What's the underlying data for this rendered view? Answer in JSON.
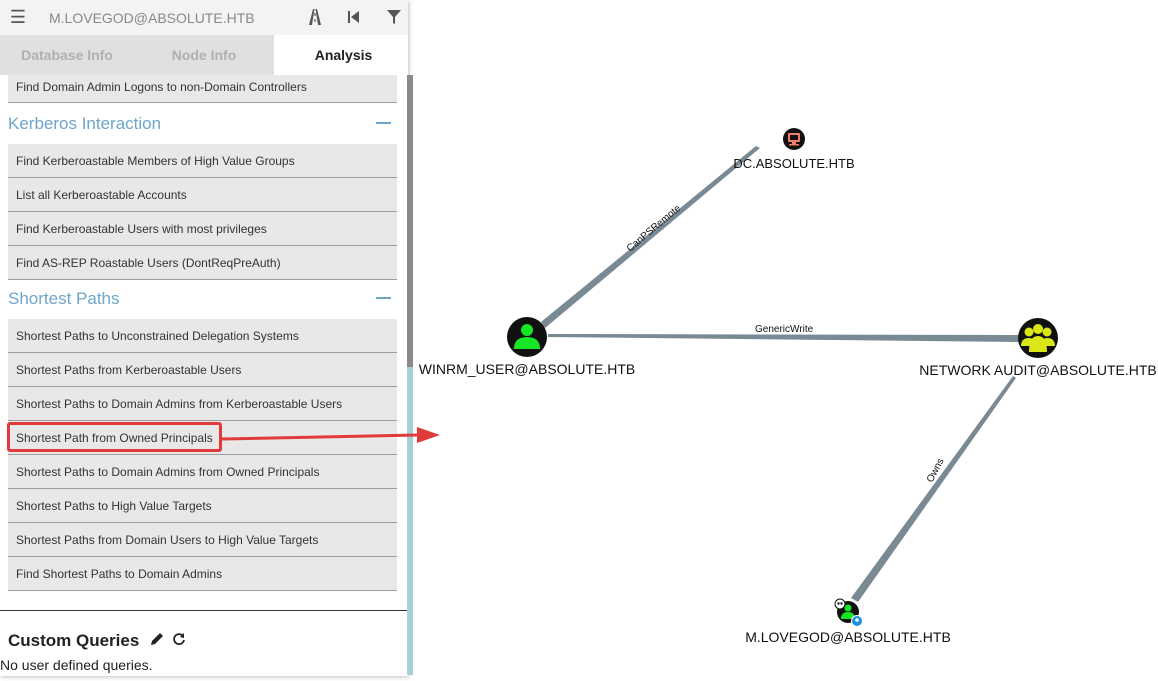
{
  "header": {
    "search_value": "M.LOVEGOD@ABSOLUTE.HTB"
  },
  "tabs": [
    {
      "label": "Database Info"
    },
    {
      "label": "Node Info"
    },
    {
      "label": "Analysis"
    }
  ],
  "analysis": {
    "top_query": "Find Domain Admin Logons to non-Domain Controllers",
    "kerberos": {
      "title": "Kerberos Interaction",
      "queries": [
        "Find Kerberoastable Members of High Value Groups",
        "List all Kerberoastable Accounts",
        "Find Kerberoastable Users with most privileges",
        "Find AS-REP Roastable Users (DontReqPreAuth)"
      ]
    },
    "shortest": {
      "title": "Shortest Paths",
      "queries": [
        "Shortest Paths to Unconstrained Delegation Systems",
        "Shortest Paths from Kerberoastable Users",
        "Shortest Paths to Domain Admins from Kerberoastable Users",
        "Shortest Path from Owned Principals",
        "Shortest Paths to Domain Admins from Owned Principals",
        "Shortest Paths to High Value Targets",
        "Shortest Paths from Domain Users to High Value Targets",
        "Find Shortest Paths to Domain Admins"
      ]
    },
    "custom": {
      "title": "Custom Queries",
      "empty_text": "No user defined queries."
    }
  },
  "graph": {
    "nodes": {
      "dc": {
        "label": "DC.ABSOLUTE.HTB",
        "type": "computer",
        "color": "#f57c6b"
      },
      "winrm": {
        "label": "WINRM_USER@ABSOLUTE.HTB",
        "type": "user",
        "color": "#17e625"
      },
      "audit": {
        "label": "NETWORK AUDIT@ABSOLUTE.HTB",
        "type": "group",
        "color": "#dbe617"
      },
      "lovegod": {
        "label": "M.LOVEGOD@ABSOLUTE.HTB",
        "type": "user-owned",
        "color": "#17e625"
      }
    },
    "edges": {
      "canps": "CanPSRemote",
      "generic": "GenericWrite",
      "owns": "Owns"
    }
  },
  "colors": {
    "accent": "#6ea5c9",
    "highlight": "#e03a3a",
    "edge": "#7a8a95"
  }
}
